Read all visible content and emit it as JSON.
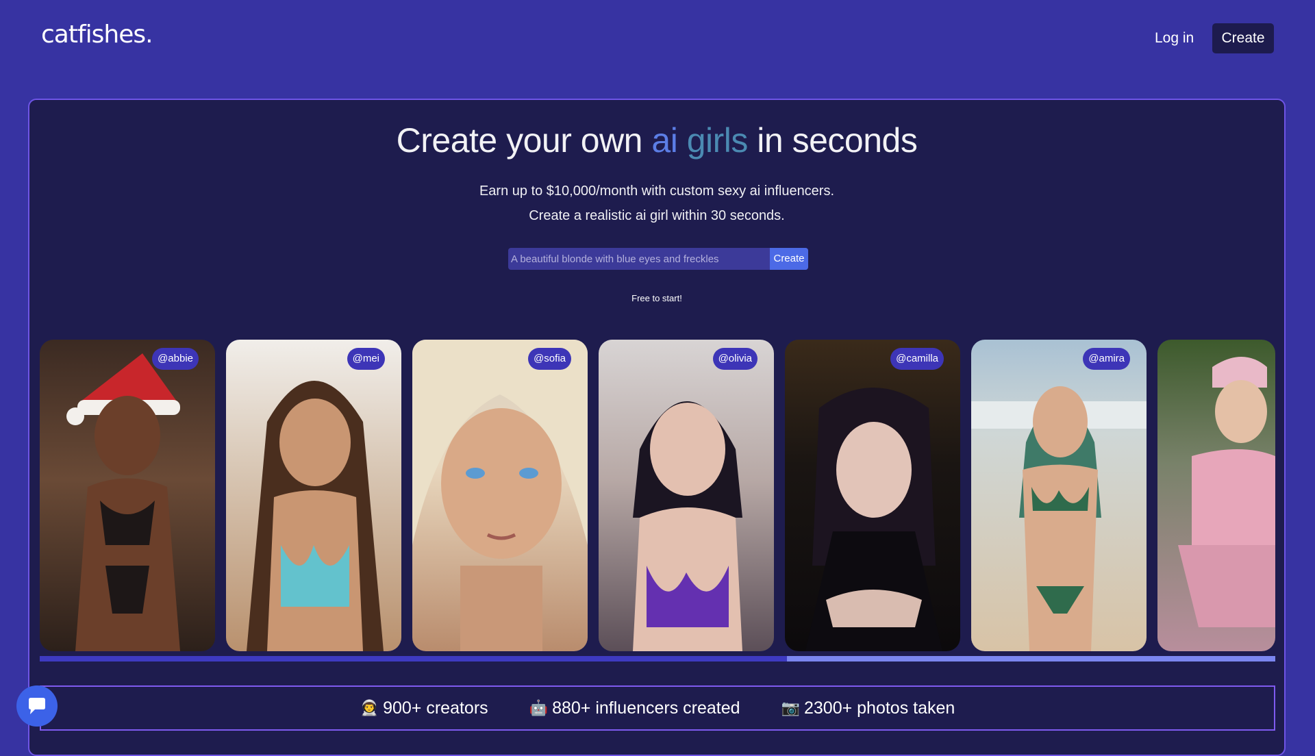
{
  "header": {
    "logo": "catfishes.",
    "login_label": "Log in",
    "create_label": "Create"
  },
  "hero": {
    "headline_pre": "Create your own ",
    "headline_accent1": "ai",
    "headline_accent2": "girls",
    "headline_post": " in seconds",
    "subline1": "Earn up to $10,000/month with custom sexy ai influencers.",
    "subline2": "Create a realistic ai girl within 30 seconds.",
    "search_placeholder": "A beautiful blonde with blue eyes and freckles",
    "search_button": "Create",
    "free_note": "Free to start!"
  },
  "gallery": {
    "cards": [
      {
        "handle": "@abbie"
      },
      {
        "handle": "@mei"
      },
      {
        "handle": "@sofia"
      },
      {
        "handle": "@olivia"
      },
      {
        "handle": "@camilla"
      },
      {
        "handle": "@amira"
      },
      {
        "handle": ""
      }
    ],
    "scroll_progress": 0.605
  },
  "stats": [
    {
      "emoji": "👨‍🚀",
      "text": "900+ creators"
    },
    {
      "emoji": "🤖",
      "text": "880+ influencers created"
    },
    {
      "emoji": "📷",
      "text": "2300+ photos taken"
    }
  ],
  "chat": {
    "icon": "chat-bubble-icon"
  },
  "colors": {
    "background": "#3733a2",
    "panel": "#1e1c4e",
    "accent_blue": "#5c7ee6",
    "button_dark": "#1d1b4e"
  }
}
